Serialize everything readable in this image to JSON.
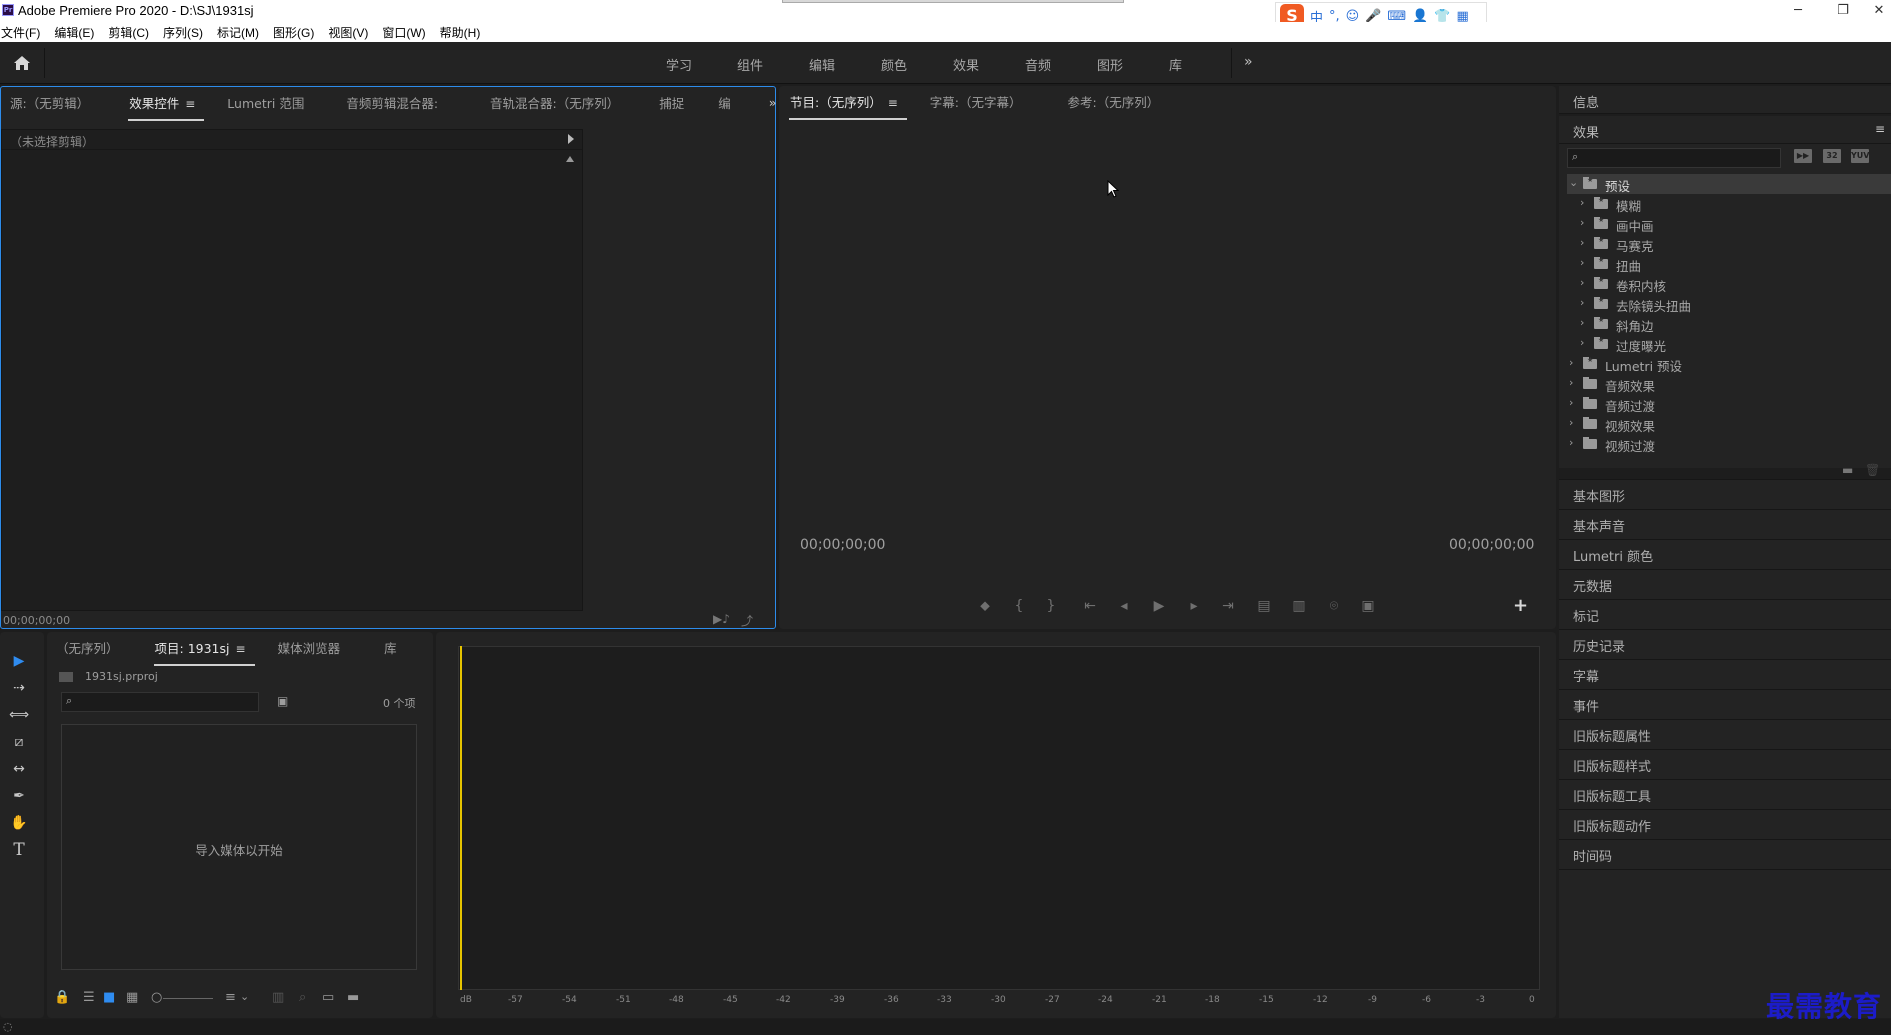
{
  "window": {
    "title": "Adobe Premiere Pro 2020 - D:\\SJ\\1931sj",
    "app_icon_text": "Pr",
    "controls": {
      "minimize": "─",
      "restore": "❐",
      "close": "✕"
    }
  },
  "ime_toolbar": {
    "logo": "S",
    "mode": "中",
    "punct": "°,",
    "icons": [
      "☺",
      "🎤",
      "⌨",
      "👤",
      "👕",
      "▦"
    ]
  },
  "menu": [
    "文件(F)",
    "编辑(E)",
    "剪辑(C)",
    "序列(S)",
    "标记(M)",
    "图形(G)",
    "视图(V)",
    "窗口(W)",
    "帮助(H)"
  ],
  "workspaces": [
    "学习",
    "组件",
    "编辑",
    "颜色",
    "效果",
    "音频",
    "图形",
    "库"
  ],
  "workspace_more": "»",
  "source_panel": {
    "tabs": [
      "源:（无剪辑）",
      "效果控件",
      "Lumetri 范围",
      "音频剪辑混合器:",
      "音轨混合器:（无序列）",
      "捕捉",
      "编"
    ],
    "active_tab_menu": "≡",
    "more": "»",
    "clip_row": "（未选择剪辑）",
    "timecode": "00;00;00;00"
  },
  "program_panel": {
    "tabs": [
      "节目:（无序列）",
      "字幕:（无字幕）",
      "参考:（无序列）"
    ],
    "active_tab_menu": "≡",
    "timecode_left": "00;00;00;00",
    "timecode_right": "00;00;00;00",
    "add_button": "+",
    "controls": [
      "⬥",
      "{",
      "}",
      "⇤",
      "◂",
      "▶",
      "▸",
      "⇥",
      "▤",
      "▥",
      "⌾",
      "▣"
    ]
  },
  "tools": [
    "▶",
    "⇢",
    "⟺",
    "⧄",
    "↔",
    "✒",
    "✋",
    "T"
  ],
  "project_panel": {
    "tabs": [
      "（无序列）",
      "项目: 1931sj",
      "媒体浏览器",
      "库"
    ],
    "active_tab_menu": "≡",
    "more": "»",
    "project_file": "1931sj.prproj",
    "item_count": "0 个项",
    "empty_message": "导入媒体以开始",
    "bottom_icons": [
      "🔒",
      "☰",
      "■",
      "▦",
      "○",
      "≡",
      "⌄",
      "▥",
      "⌕",
      "▭",
      "▬"
    ]
  },
  "timeline_panel": {
    "scale": [
      "dB",
      "-57",
      "-54",
      "-51",
      "-48",
      "-45",
      "-42",
      "-39",
      "-36",
      "-33",
      "-30",
      "-27",
      "-24",
      "-21",
      "-18",
      "-15",
      "-12",
      "-9",
      "-6",
      "-3",
      "0"
    ]
  },
  "right_panels": {
    "info_label": "信息",
    "effects_label": "效果",
    "effects_menu": "≡",
    "effects_icons": [
      "▶▶",
      "32",
      "YUV"
    ],
    "tree": [
      {
        "label": "预设",
        "level": 0,
        "expanded": true,
        "star": true,
        "selected": true
      },
      {
        "label": "模糊",
        "level": 1,
        "star": true
      },
      {
        "label": "画中画",
        "level": 1,
        "star": true
      },
      {
        "label": "马赛克",
        "level": 1,
        "star": true
      },
      {
        "label": "扭曲",
        "level": 1,
        "star": true
      },
      {
        "label": "卷积内核",
        "level": 1,
        "star": true
      },
      {
        "label": "去除镜头扭曲",
        "level": 1,
        "star": true
      },
      {
        "label": "斜角边",
        "level": 1,
        "star": true
      },
      {
        "label": "过度曝光",
        "level": 1,
        "star": true
      },
      {
        "label": "Lumetri 预设",
        "level": 0,
        "star": true
      },
      {
        "label": "音频效果",
        "level": 0
      },
      {
        "label": "音频过渡",
        "level": 0
      },
      {
        "label": "视频效果",
        "level": 0
      },
      {
        "label": "视频过渡",
        "level": 0
      }
    ],
    "collapsed_panels": [
      "基本图形",
      "基本声音",
      "Lumetri 颜色",
      "元数据",
      "标记",
      "历史记录",
      "字幕",
      "事件",
      "旧版标题属性",
      "旧版标题样式",
      "旧版标题工具",
      "旧版标题动作",
      "时间码"
    ]
  },
  "watermark": "最需教育",
  "status_icon": "◌"
}
